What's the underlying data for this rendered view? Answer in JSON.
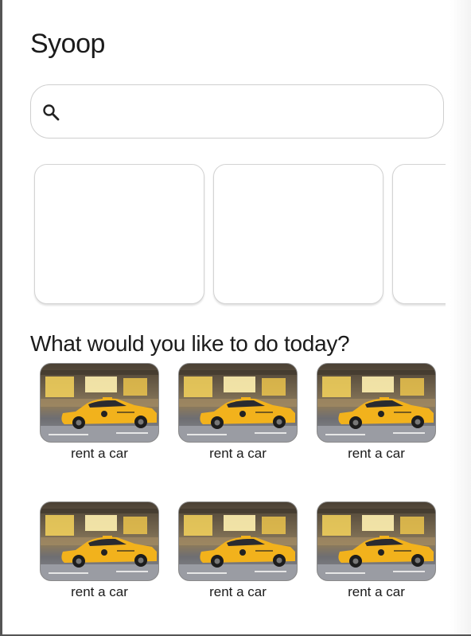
{
  "app": {
    "title": "Syoop"
  },
  "search": {
    "placeholder": "",
    "value": "",
    "icon": "search-icon"
  },
  "carousel": {
    "cards": [
      {},
      {},
      {}
    ]
  },
  "actions": {
    "heading": "What would you like to do today?",
    "items": [
      {
        "label": "rent a car",
        "image": "taxi-photo"
      },
      {
        "label": "rent a car",
        "image": "taxi-photo"
      },
      {
        "label": "rent a car",
        "image": "taxi-photo"
      },
      {
        "label": "rent a car",
        "image": "taxi-photo"
      },
      {
        "label": "rent a car",
        "image": "taxi-photo"
      },
      {
        "label": "rent a car",
        "image": "taxi-photo"
      }
    ]
  },
  "colors": {
    "taxi_yellow": "#f2b21c",
    "border": "#cfcfcf",
    "text": "#1b1b1b"
  }
}
